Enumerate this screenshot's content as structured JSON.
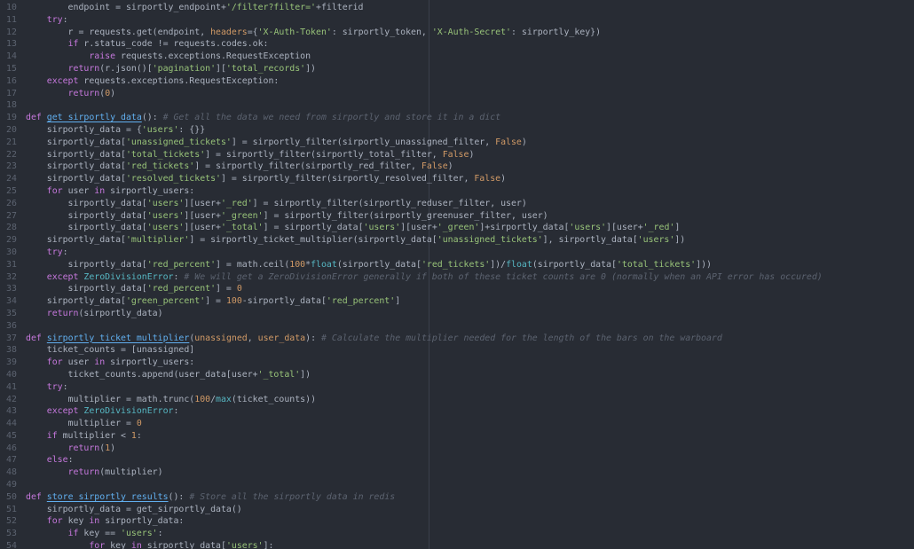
{
  "editor": {
    "theme_colors": {
      "background": "#282c34",
      "gutter_text": "#5c6370",
      "plain": "#abb2bf",
      "keyword": "#c678dd",
      "string": "#98c379",
      "number": "#d19a66",
      "function": "#61afef",
      "builtin": "#56b6c2",
      "comment": "#5c6370"
    },
    "lines": [
      {
        "n": "10",
        "tokens": [
          [
            "plain",
            "        endpoint = sirportly_endpoint+"
          ],
          [
            "string",
            "'/filter?filter='"
          ],
          [
            "plain",
            "+filterid"
          ]
        ]
      },
      {
        "n": "11",
        "tokens": [
          [
            "plain",
            "    "
          ],
          [
            "keyword",
            "try"
          ],
          [
            "plain",
            ":"
          ]
        ]
      },
      {
        "n": "12",
        "tokens": [
          [
            "plain",
            "        r = requests.get(endpoint, "
          ],
          [
            "param",
            "headers"
          ],
          [
            "plain",
            "={"
          ],
          [
            "string",
            "'X-Auth-Token'"
          ],
          [
            "plain",
            ": sirportly_token, "
          ],
          [
            "string",
            "'X-Auth-Secret'"
          ],
          [
            "plain",
            ": sirportly_key})"
          ]
        ]
      },
      {
        "n": "13",
        "tokens": [
          [
            "plain",
            "        "
          ],
          [
            "keyword",
            "if"
          ],
          [
            "plain",
            " r.status_code != requests.codes.ok:"
          ]
        ]
      },
      {
        "n": "14",
        "tokens": [
          [
            "plain",
            "            "
          ],
          [
            "keyword",
            "raise"
          ],
          [
            "plain",
            " requests.exceptions.RequestException"
          ]
        ]
      },
      {
        "n": "15",
        "tokens": [
          [
            "plain",
            "        "
          ],
          [
            "keyword",
            "return"
          ],
          [
            "plain",
            "(r.json()["
          ],
          [
            "string",
            "'pagination'"
          ],
          [
            "plain",
            "]["
          ],
          [
            "string",
            "'total_records'"
          ],
          [
            "plain",
            "])"
          ]
        ]
      },
      {
        "n": "16",
        "tokens": [
          [
            "plain",
            "    "
          ],
          [
            "keyword",
            "except"
          ],
          [
            "plain",
            " requests.exceptions.RequestException:"
          ]
        ]
      },
      {
        "n": "17",
        "tokens": [
          [
            "plain",
            "        "
          ],
          [
            "keyword",
            "return"
          ],
          [
            "plain",
            "("
          ],
          [
            "number",
            "0"
          ],
          [
            "plain",
            ")"
          ]
        ]
      },
      {
        "n": "18",
        "tokens": []
      },
      {
        "n": "19",
        "tokens": [
          [
            "keyword",
            "def"
          ],
          [
            "plain",
            " "
          ],
          [
            "func",
            "get_sirportly_data"
          ],
          [
            "plain",
            "(): "
          ],
          [
            "comment",
            "# Get all the data we need from sirportly and store it in a dict"
          ]
        ]
      },
      {
        "n": "20",
        "tokens": [
          [
            "plain",
            "    sirportly_data = {"
          ],
          [
            "string",
            "'users'"
          ],
          [
            "plain",
            ": {}}"
          ]
        ]
      },
      {
        "n": "21",
        "tokens": [
          [
            "plain",
            "    sirportly_data["
          ],
          [
            "string",
            "'unassigned_tickets'"
          ],
          [
            "plain",
            "] = sirportly_filter(sirportly_unassigned_filter, "
          ],
          [
            "bool",
            "False"
          ],
          [
            "plain",
            ")"
          ]
        ]
      },
      {
        "n": "22",
        "tokens": [
          [
            "plain",
            "    sirportly_data["
          ],
          [
            "string",
            "'total_tickets'"
          ],
          [
            "plain",
            "] = sirportly_filter(sirportly_total_filter, "
          ],
          [
            "bool",
            "False"
          ],
          [
            "plain",
            ")"
          ]
        ]
      },
      {
        "n": "23",
        "tokens": [
          [
            "plain",
            "    sirportly_data["
          ],
          [
            "string",
            "'red_tickets'"
          ],
          [
            "plain",
            "] = sirportly_filter(sirportly_red_filter, "
          ],
          [
            "bool",
            "False"
          ],
          [
            "plain",
            ")"
          ]
        ]
      },
      {
        "n": "24",
        "tokens": [
          [
            "plain",
            "    sirportly_data["
          ],
          [
            "string",
            "'resolved_tickets'"
          ],
          [
            "plain",
            "] = sirportly_filter(sirportly_resolved_filter, "
          ],
          [
            "bool",
            "False"
          ],
          [
            "plain",
            ")"
          ]
        ]
      },
      {
        "n": "25",
        "tokens": [
          [
            "plain",
            "    "
          ],
          [
            "keyword",
            "for"
          ],
          [
            "plain",
            " user "
          ],
          [
            "keyword",
            "in"
          ],
          [
            "plain",
            " sirportly_users:"
          ]
        ]
      },
      {
        "n": "26",
        "tokens": [
          [
            "plain",
            "        sirportly_data["
          ],
          [
            "string",
            "'users'"
          ],
          [
            "plain",
            "][user+"
          ],
          [
            "string",
            "'_red'"
          ],
          [
            "plain",
            "] = sirportly_filter(sirportly_reduser_filter, user)"
          ]
        ]
      },
      {
        "n": "27",
        "tokens": [
          [
            "plain",
            "        sirportly_data["
          ],
          [
            "string",
            "'users'"
          ],
          [
            "plain",
            "][user+"
          ],
          [
            "string",
            "'_green'"
          ],
          [
            "plain",
            "] = sirportly_filter(sirportly_greenuser_filter, user)"
          ]
        ]
      },
      {
        "n": "28",
        "tokens": [
          [
            "plain",
            "        sirportly_data["
          ],
          [
            "string",
            "'users'"
          ],
          [
            "plain",
            "][user+"
          ],
          [
            "string",
            "'_total'"
          ],
          [
            "plain",
            "] = sirportly_data["
          ],
          [
            "string",
            "'users'"
          ],
          [
            "plain",
            "][user+"
          ],
          [
            "string",
            "'_green'"
          ],
          [
            "plain",
            "]+sirportly_data["
          ],
          [
            "string",
            "'users'"
          ],
          [
            "plain",
            "][user+"
          ],
          [
            "string",
            "'_red'"
          ],
          [
            "plain",
            "]"
          ]
        ]
      },
      {
        "n": "29",
        "tokens": [
          [
            "plain",
            "    sirportly_data["
          ],
          [
            "string",
            "'multiplier'"
          ],
          [
            "plain",
            "] = sirportly_ticket_multiplier(sirportly_data["
          ],
          [
            "string",
            "'unassigned_tickets'"
          ],
          [
            "plain",
            "], sirportly_data["
          ],
          [
            "string",
            "'users'"
          ],
          [
            "plain",
            "])"
          ]
        ]
      },
      {
        "n": "30",
        "tokens": [
          [
            "plain",
            "    "
          ],
          [
            "keyword",
            "try"
          ],
          [
            "plain",
            ":"
          ]
        ]
      },
      {
        "n": "31",
        "tokens": [
          [
            "plain",
            "        sirportly_data["
          ],
          [
            "string",
            "'red_percent'"
          ],
          [
            "plain",
            "] = math.ceil("
          ],
          [
            "number",
            "100"
          ],
          [
            "plain",
            "*"
          ],
          [
            "builtin",
            "float"
          ],
          [
            "plain",
            "(sirportly_data["
          ],
          [
            "string",
            "'red_tickets'"
          ],
          [
            "plain",
            "])/"
          ],
          [
            "builtin",
            "float"
          ],
          [
            "plain",
            "(sirportly_data["
          ],
          [
            "string",
            "'total_tickets'"
          ],
          [
            "plain",
            "]))"
          ]
        ]
      },
      {
        "n": "32",
        "tokens": [
          [
            "plain",
            "    "
          ],
          [
            "keyword",
            "except"
          ],
          [
            "plain",
            " "
          ],
          [
            "class",
            "ZeroDivisionError"
          ],
          [
            "plain",
            ": "
          ],
          [
            "comment",
            "# We will get a ZeroDivisionError generally if both of these ticket counts are 0 (normally when an API error has occured)"
          ]
        ]
      },
      {
        "n": "33",
        "tokens": [
          [
            "plain",
            "        sirportly_data["
          ],
          [
            "string",
            "'red_percent'"
          ],
          [
            "plain",
            "] = "
          ],
          [
            "number",
            "0"
          ]
        ]
      },
      {
        "n": "34",
        "tokens": [
          [
            "plain",
            "    sirportly_data["
          ],
          [
            "string",
            "'green_percent'"
          ],
          [
            "plain",
            "] = "
          ],
          [
            "number",
            "100"
          ],
          [
            "plain",
            "-sirportly_data["
          ],
          [
            "string",
            "'red_percent'"
          ],
          [
            "plain",
            "]"
          ]
        ]
      },
      {
        "n": "35",
        "tokens": [
          [
            "plain",
            "    "
          ],
          [
            "keyword",
            "return"
          ],
          [
            "plain",
            "(sirportly_data)"
          ]
        ]
      },
      {
        "n": "36",
        "tokens": []
      },
      {
        "n": "37",
        "tokens": [
          [
            "keyword",
            "def"
          ],
          [
            "plain",
            " "
          ],
          [
            "func",
            "sirportly_ticket_multiplier"
          ],
          [
            "plain",
            "("
          ],
          [
            "param",
            "unassigned"
          ],
          [
            "plain",
            ", "
          ],
          [
            "param",
            "user_data"
          ],
          [
            "plain",
            "): "
          ],
          [
            "comment",
            "# Calculate the multiplier needed for the length of the bars on the warboard"
          ]
        ]
      },
      {
        "n": "38",
        "tokens": [
          [
            "plain",
            "    ticket_counts = [unassigned]"
          ]
        ]
      },
      {
        "n": "39",
        "tokens": [
          [
            "plain",
            "    "
          ],
          [
            "keyword",
            "for"
          ],
          [
            "plain",
            " user "
          ],
          [
            "keyword",
            "in"
          ],
          [
            "plain",
            " sirportly_users:"
          ]
        ]
      },
      {
        "n": "40",
        "tokens": [
          [
            "plain",
            "        ticket_counts.append(user_data[user+"
          ],
          [
            "string",
            "'_total'"
          ],
          [
            "plain",
            "])"
          ]
        ]
      },
      {
        "n": "41",
        "tokens": [
          [
            "plain",
            "    "
          ],
          [
            "keyword",
            "try"
          ],
          [
            "plain",
            ":"
          ]
        ]
      },
      {
        "n": "42",
        "tokens": [
          [
            "plain",
            "        multiplier = math.trunc("
          ],
          [
            "number",
            "100"
          ],
          [
            "plain",
            "/"
          ],
          [
            "builtin",
            "max"
          ],
          [
            "plain",
            "(ticket_counts))"
          ]
        ]
      },
      {
        "n": "43",
        "tokens": [
          [
            "plain",
            "    "
          ],
          [
            "keyword",
            "except"
          ],
          [
            "plain",
            " "
          ],
          [
            "class",
            "ZeroDivisionError"
          ],
          [
            "plain",
            ":"
          ]
        ]
      },
      {
        "n": "44",
        "tokens": [
          [
            "plain",
            "        multiplier = "
          ],
          [
            "number",
            "0"
          ]
        ]
      },
      {
        "n": "45",
        "tokens": [
          [
            "plain",
            "    "
          ],
          [
            "keyword",
            "if"
          ],
          [
            "plain",
            " multiplier < "
          ],
          [
            "number",
            "1"
          ],
          [
            "plain",
            ":"
          ]
        ]
      },
      {
        "n": "46",
        "tokens": [
          [
            "plain",
            "        "
          ],
          [
            "keyword",
            "return"
          ],
          [
            "plain",
            "("
          ],
          [
            "number",
            "1"
          ],
          [
            "plain",
            ")"
          ]
        ]
      },
      {
        "n": "47",
        "tokens": [
          [
            "plain",
            "    "
          ],
          [
            "keyword",
            "else"
          ],
          [
            "plain",
            ":"
          ]
        ]
      },
      {
        "n": "48",
        "tokens": [
          [
            "plain",
            "        "
          ],
          [
            "keyword",
            "return"
          ],
          [
            "plain",
            "(multiplier)"
          ]
        ]
      },
      {
        "n": "49",
        "tokens": []
      },
      {
        "n": "50",
        "tokens": [
          [
            "keyword",
            "def"
          ],
          [
            "plain",
            " "
          ],
          [
            "func",
            "store_sirportly_results"
          ],
          [
            "plain",
            "(): "
          ],
          [
            "comment",
            "# Store all the sirportly data in redis"
          ]
        ]
      },
      {
        "n": "51",
        "tokens": [
          [
            "plain",
            "    sirportly_data = get_sirportly_data()"
          ]
        ]
      },
      {
        "n": "52",
        "tokens": [
          [
            "plain",
            "    "
          ],
          [
            "keyword",
            "for"
          ],
          [
            "plain",
            " key "
          ],
          [
            "keyword",
            "in"
          ],
          [
            "plain",
            " sirportly_data:"
          ]
        ]
      },
      {
        "n": "53",
        "tokens": [
          [
            "plain",
            "        "
          ],
          [
            "keyword",
            "if"
          ],
          [
            "plain",
            " key == "
          ],
          [
            "string",
            "'users'"
          ],
          [
            "plain",
            ":"
          ]
        ]
      },
      {
        "n": "54",
        "tokens": [
          [
            "plain",
            "            "
          ],
          [
            "keyword",
            "for"
          ],
          [
            "plain",
            " key "
          ],
          [
            "keyword",
            "in"
          ],
          [
            "plain",
            " sirportly_data["
          ],
          [
            "string",
            "'users'"
          ],
          [
            "plain",
            "]:"
          ]
        ]
      }
    ]
  }
}
